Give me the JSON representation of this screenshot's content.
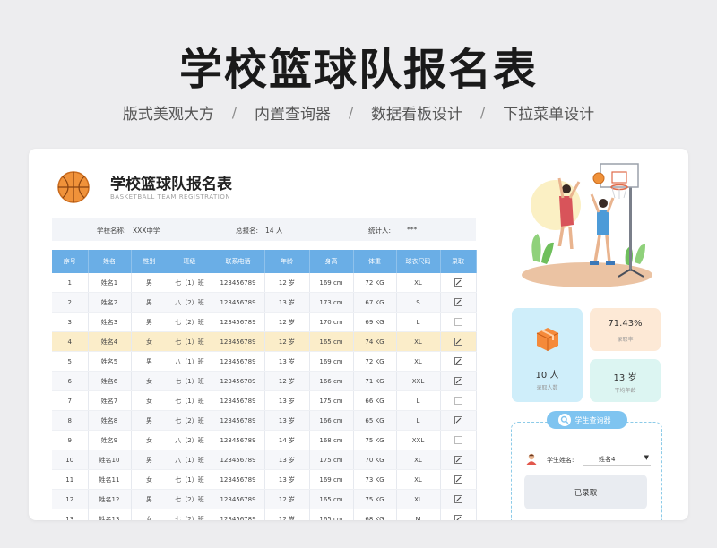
{
  "header": {
    "title": "学校篮球队报名表",
    "features": [
      "版式美观大方",
      "内置查询器",
      "数据看板设计",
      "下拉菜单设计"
    ],
    "separator": "/"
  },
  "card": {
    "title": "学校篮球队报名表",
    "subtitle": "BASKETBALL TEAM REGISTRATION",
    "info": {
      "school_label": "学校名称:",
      "school_value": "XXX中学",
      "total_label": "总报名:",
      "total_value": "14 人",
      "stat_label": "统计人:",
      "stat_value": "***"
    }
  },
  "table": {
    "columns": [
      "序号",
      "姓名",
      "性别",
      "班级",
      "联系电话",
      "年龄",
      "身高",
      "体重",
      "球衣尺码",
      "录取"
    ],
    "rows": [
      {
        "no": "1",
        "name": "姓名1",
        "gender": "男",
        "class": "七（1）班",
        "phone": "123456789",
        "age": "12 岁",
        "height": "169 cm",
        "weight": "72 KG",
        "size": "XL",
        "admitted": true,
        "highlight": false
      },
      {
        "no": "2",
        "name": "姓名2",
        "gender": "男",
        "class": "八（2）班",
        "phone": "123456789",
        "age": "13 岁",
        "height": "173 cm",
        "weight": "67 KG",
        "size": "S",
        "admitted": true,
        "highlight": false
      },
      {
        "no": "3",
        "name": "姓名3",
        "gender": "男",
        "class": "七（2）班",
        "phone": "123456789",
        "age": "12 岁",
        "height": "170 cm",
        "weight": "69 KG",
        "size": "L",
        "admitted": false,
        "highlight": false
      },
      {
        "no": "4",
        "name": "姓名4",
        "gender": "女",
        "class": "七（1）班",
        "phone": "123456789",
        "age": "12 岁",
        "height": "165 cm",
        "weight": "74 KG",
        "size": "XL",
        "admitted": true,
        "highlight": true
      },
      {
        "no": "5",
        "name": "姓名5",
        "gender": "男",
        "class": "八（1）班",
        "phone": "123456789",
        "age": "13 岁",
        "height": "169 cm",
        "weight": "72 KG",
        "size": "XL",
        "admitted": true,
        "highlight": false
      },
      {
        "no": "6",
        "name": "姓名6",
        "gender": "女",
        "class": "七（1）班",
        "phone": "123456789",
        "age": "12 岁",
        "height": "166 cm",
        "weight": "71 KG",
        "size": "XXL",
        "admitted": true,
        "highlight": false
      },
      {
        "no": "7",
        "name": "姓名7",
        "gender": "女",
        "class": "七（1）班",
        "phone": "123456789",
        "age": "13 岁",
        "height": "175 cm",
        "weight": "66 KG",
        "size": "L",
        "admitted": false,
        "highlight": false
      },
      {
        "no": "8",
        "name": "姓名8",
        "gender": "男",
        "class": "七（2）班",
        "phone": "123456789",
        "age": "13 岁",
        "height": "166 cm",
        "weight": "65 KG",
        "size": "L",
        "admitted": true,
        "highlight": false
      },
      {
        "no": "9",
        "name": "姓名9",
        "gender": "女",
        "class": "八（2）班",
        "phone": "123456789",
        "age": "14 岁",
        "height": "168 cm",
        "weight": "75 KG",
        "size": "XXL",
        "admitted": false,
        "highlight": false
      },
      {
        "no": "10",
        "name": "姓名10",
        "gender": "男",
        "class": "八（1）班",
        "phone": "123456789",
        "age": "13 岁",
        "height": "175 cm",
        "weight": "70 KG",
        "size": "XL",
        "admitted": true,
        "highlight": false
      },
      {
        "no": "11",
        "name": "姓名11",
        "gender": "女",
        "class": "七（1）班",
        "phone": "123456789",
        "age": "13 岁",
        "height": "169 cm",
        "weight": "73 KG",
        "size": "XL",
        "admitted": true,
        "highlight": false
      },
      {
        "no": "12",
        "name": "姓名12",
        "gender": "男",
        "class": "七（2）班",
        "phone": "123456789",
        "age": "12 岁",
        "height": "165 cm",
        "weight": "75 KG",
        "size": "XL",
        "admitted": true,
        "highlight": false
      },
      {
        "no": "13",
        "name": "姓名13",
        "gender": "女",
        "class": "七（2）班",
        "phone": "123456789",
        "age": "12 岁",
        "height": "165 cm",
        "weight": "68 KG",
        "size": "M",
        "admitted": true,
        "highlight": false
      }
    ]
  },
  "dashboard": {
    "count_value": "10 人",
    "count_label": "录取人数",
    "rate_value": "71.43%",
    "rate_label": "录取率",
    "age_value": "13 岁",
    "age_label": "平均年龄"
  },
  "query": {
    "tag": "学生查询器",
    "student_label": "学生姓名:",
    "student_value": "姓名4",
    "status": "已录取"
  },
  "colors": {
    "table_header": "#6aaee6",
    "highlight_row": "#fbedc9",
    "query_accent": "#7fc4f0"
  }
}
